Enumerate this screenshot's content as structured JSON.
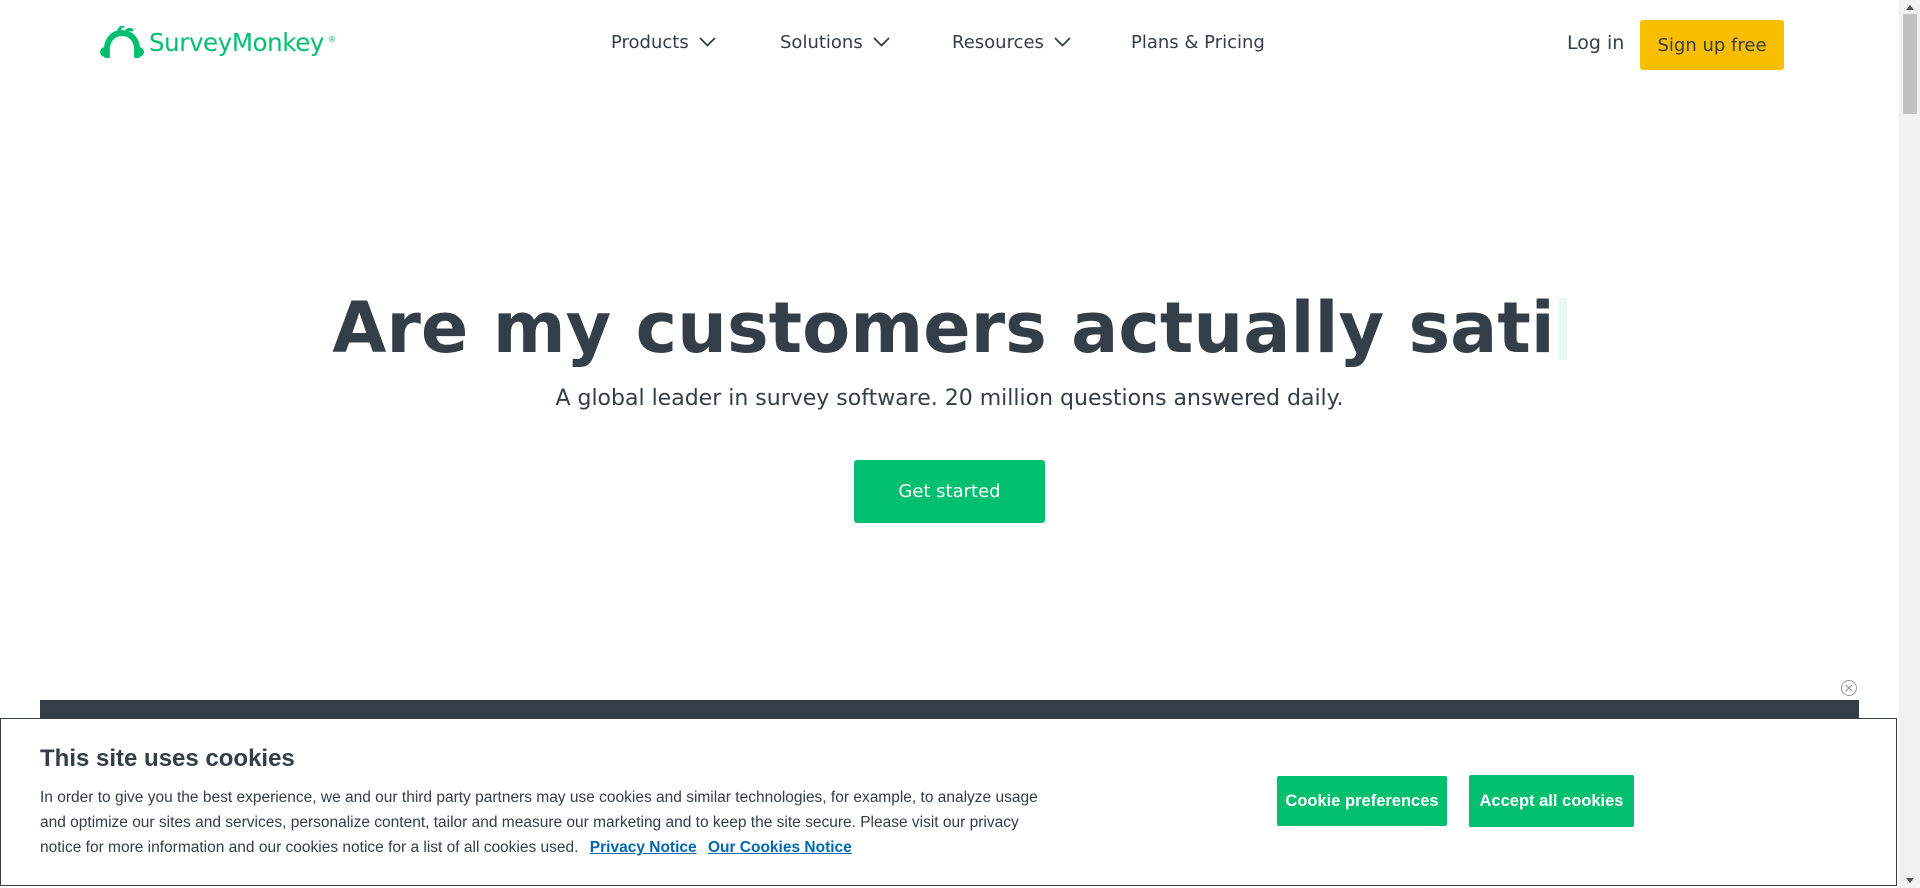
{
  "header": {
    "logo_text": "SurveyMonkey",
    "logo_mark": "®",
    "nav": [
      {
        "label": "Products",
        "has_dropdown": true
      },
      {
        "label": "Solutions",
        "has_dropdown": true
      },
      {
        "label": "Resources",
        "has_dropdown": true
      },
      {
        "label": "Plans & Pricing",
        "has_dropdown": false
      }
    ],
    "login_label": "Log in",
    "signup_label": "Sign up free"
  },
  "hero": {
    "headline": "Are my customers actually sati",
    "subheadline": "A global leader in survey software. 20 million questions answered daily.",
    "cta_label": "Get started"
  },
  "cookie_banner": {
    "title": "This site uses cookies",
    "body": "In order to give you the best experience, we and our third party partners may use cookies and similar technologies, for example, to analyze usage and optimize our sites and services, personalize content, tailor and measure our marketing and to keep the site secure. Please visit our privacy notice for more information and our cookies notice for a list of all cookies used.",
    "privacy_link": "Privacy Notice",
    "cookies_link": "Our Cookies Notice",
    "preferences_label": "Cookie preferences",
    "accept_label": "Accept all cookies"
  },
  "colors": {
    "brand_green": "#00bf6f",
    "signup_yellow": "#f9be00",
    "text_dark": "#333e48",
    "link_blue": "#0066b2"
  },
  "icons": {
    "logo": "monkey-logo-icon",
    "dropdown": "chevron-down-icon",
    "close": "close-circle-icon",
    "scroll_up": "triangle-up-icon",
    "scroll_down": "triangle-down-icon"
  }
}
